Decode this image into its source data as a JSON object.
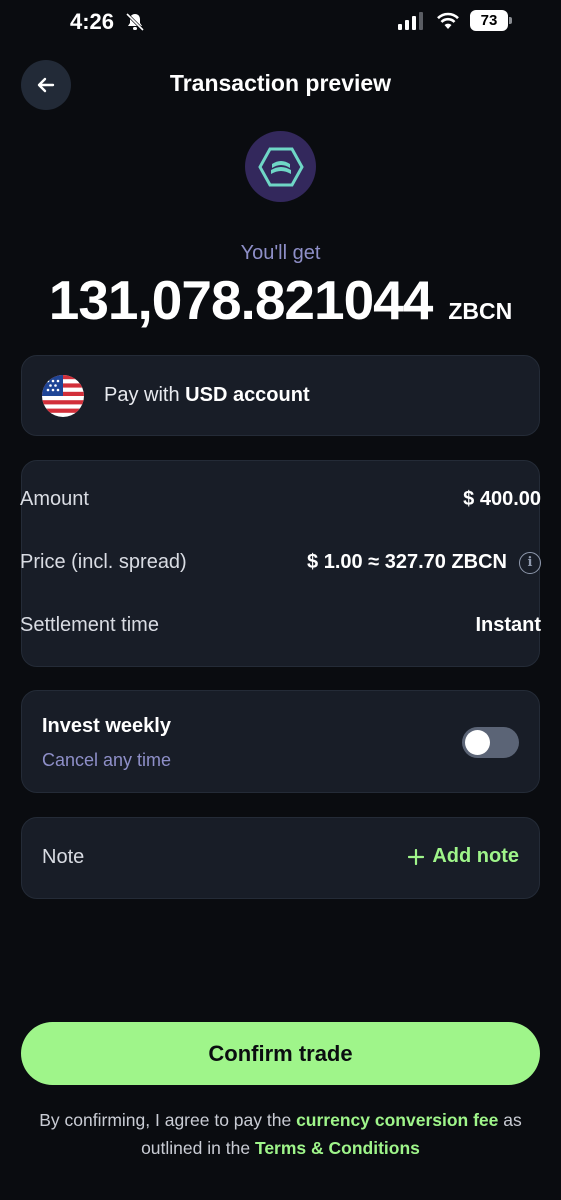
{
  "status_bar": {
    "time": "4:26",
    "battery": "73"
  },
  "header": {
    "title": "Transaction preview"
  },
  "receive": {
    "label": "You'll get",
    "amount": "131,078.821044",
    "currency": "ZBCN"
  },
  "pay_with": {
    "prefix": "Pay with",
    "account": "USD account"
  },
  "details": [
    {
      "label": "Amount",
      "value": "$ 400.00"
    },
    {
      "label": "Price (incl. spread)",
      "value": "$ 1.00 ≈ 327.70 ZBCN"
    },
    {
      "label": "Settlement time",
      "value": "Instant"
    }
  ],
  "invest": {
    "title": "Invest weekly",
    "subtitle": "Cancel any time",
    "enabled": false
  },
  "note": {
    "label": "Note",
    "action": "Add note"
  },
  "confirm_label": "Confirm trade",
  "disclaimer": {
    "text1": "By confirming, I agree to pay the",
    "link1": "currency conversion fee",
    "text2": "as outlined in the",
    "link2": "Terms & Conditions"
  },
  "colors": {
    "accent": "#9ff58a",
    "background": "#0a0c10",
    "card": "#181d27",
    "muted": "#8e8fc8"
  },
  "icons": [
    "back-arrow-icon",
    "bell-muted-icon",
    "signal-icon",
    "wifi-icon",
    "info-icon",
    "plus-icon",
    "zbcn-coin-icon",
    "us-flag-icon"
  ]
}
